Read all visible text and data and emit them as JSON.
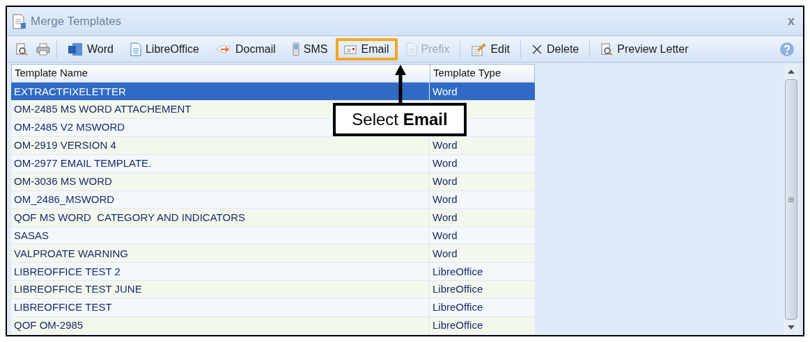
{
  "window": {
    "title": "Merge Templates",
    "close": "x"
  },
  "toolbar": [
    {
      "kind": "icon"
    },
    {
      "kind": "icon"
    },
    {
      "kind": "button",
      "label": "Word",
      "disabled": false,
      "highlighted": false
    },
    {
      "kind": "button",
      "label": "LibreOffice",
      "disabled": false,
      "highlighted": false
    },
    {
      "kind": "button",
      "label": "Docmail",
      "disabled": false,
      "highlighted": false
    },
    {
      "kind": "button",
      "label": "SMS",
      "disabled": false,
      "highlighted": false
    },
    {
      "kind": "button",
      "label": "Email",
      "disabled": false,
      "highlighted": true
    },
    {
      "kind": "button",
      "label": "Prefix",
      "disabled": true,
      "highlighted": false
    },
    {
      "kind": "button",
      "label": "Edit",
      "disabled": false,
      "highlighted": false
    },
    {
      "kind": "button",
      "label": "Delete",
      "disabled": false,
      "highlighted": false
    },
    {
      "kind": "button",
      "label": "Preview Letter",
      "disabled": false,
      "highlighted": false
    }
  ],
  "table": {
    "columns": [
      "Template Name",
      "Template Type"
    ],
    "rows": [
      {
        "name": "EXTRACTFIXELETTER",
        "type": "Word",
        "selected": true
      },
      {
        "name": "OM-2485 MS WORD ATTACHEMENT",
        "selected": false
      },
      {
        "name": "OM-2485 V2 MSWORD",
        "selected": false
      },
      {
        "name": "OM-2919 VERSION 4",
        "type": "Word",
        "selected": false
      },
      {
        "name": "OM-2977 EMAIL TEMPLATE.",
        "type": "Word",
        "selected": false
      },
      {
        "name": "OM-3036 MS WORD",
        "type": "Word",
        "selected": false
      },
      {
        "name": "OM_2486_MSWORD",
        "type": "Word",
        "selected": false
      },
      {
        "name": "QOF MS WORD  CATEGORY AND INDICATORS",
        "type": "Word",
        "selected": false
      },
      {
        "name": "SASAS",
        "type": "Word",
        "selected": false
      },
      {
        "name": "VALPROATE WARNING",
        "type": "Word",
        "selected": false
      },
      {
        "name": "LIBREOFFICE TEST 2",
        "type": "LibreOffice",
        "selected": false
      },
      {
        "name": "LIBREOFFICE TEST JUNE",
        "type": "LibreOffice",
        "selected": false
      },
      {
        "name": "LIBREOFFICE TEST",
        "type": "LibreOffice",
        "selected": false
      },
      {
        "name": "QOF OM-2985",
        "type": "LibreOffice",
        "selected": false
      }
    ]
  },
  "callout": {
    "text": "Select **Email**"
  }
}
